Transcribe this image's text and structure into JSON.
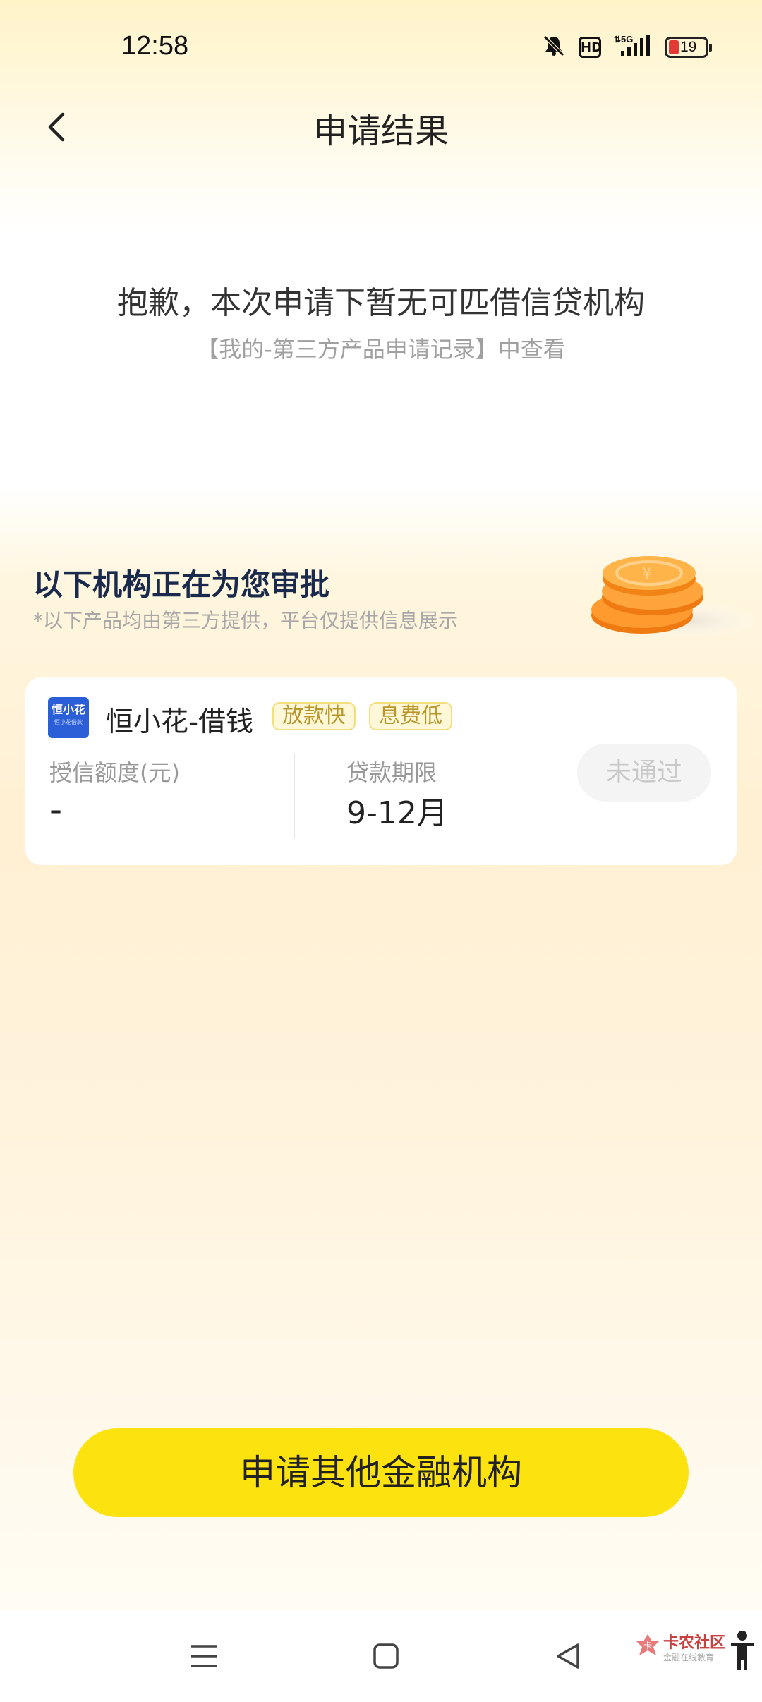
{
  "status_bar": {
    "time": "12:58",
    "network": "5G",
    "battery": "19",
    "icons": [
      "bell-off-icon",
      "hd-icon",
      "signal-icon",
      "battery-icon"
    ]
  },
  "header": {
    "back_icon": "chevron-left-icon",
    "title": "申请结果"
  },
  "result": {
    "message": "抱歉，本次申请下暂无可匹借信贷机构",
    "hint": "【我的-第三方产品申请记录】中查看"
  },
  "section": {
    "title": "以下机构正在为您审批",
    "note": "*以下产品均由第三方提供，平台仅提供信息展示",
    "graphic": "coins-illustration"
  },
  "product": {
    "logo_text": "恒小花",
    "logo_subtext": "恒小花借款",
    "name": "恒小花-借钱",
    "tags": [
      "放款快",
      "息费低"
    ],
    "credit_label": "授信额度(元)",
    "credit_value": "-",
    "term_label": "贷款期限",
    "term_value": "9-12月",
    "status": "未通过"
  },
  "actions": {
    "apply_other": "申请其他金融机构"
  },
  "nav_bar": {
    "icons": [
      "menu-icon",
      "home-square-icon",
      "back-triangle-icon"
    ],
    "watermark": "卡农社区",
    "watermark_sub": "金融在线教育"
  },
  "colors": {
    "accent": "#FCE20E",
    "title_navy": "#1A2A4C",
    "tag_text": "#B8962A",
    "logo_blue": "#2B5FD8"
  }
}
